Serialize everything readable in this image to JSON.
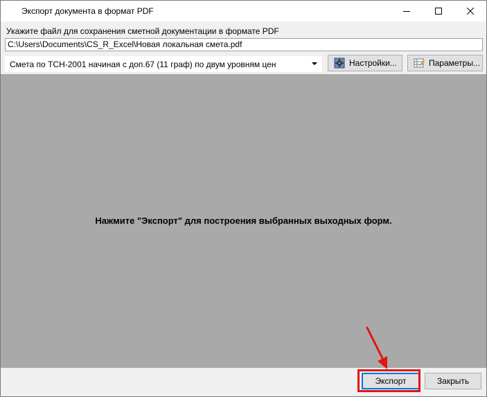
{
  "window": {
    "title": "Экспорт документа в формат PDF"
  },
  "form": {
    "hint_label": "Укажите файл для сохранения сметной документации в формате PDF",
    "file_path": "C:\\Users\\Documents\\CS_R_Excel\\Новая локальная смета.pdf",
    "output_form_selected": "Смета по ТСН-2001 начиная с доп.67 (11 граф) по двум уровням цен"
  },
  "toolbar": {
    "settings_label": "Настройки...",
    "params_label": "Параметры..."
  },
  "preview": {
    "message": "Нажмите \"Экспорт\" для построения выбранных выходных форм."
  },
  "footer": {
    "export_label": "Экспорт",
    "close_label": "Закрыть"
  },
  "colors": {
    "preview_bg": "#a9a9a9",
    "annotation": "#e31414",
    "focus_border": "#0078d7"
  }
}
